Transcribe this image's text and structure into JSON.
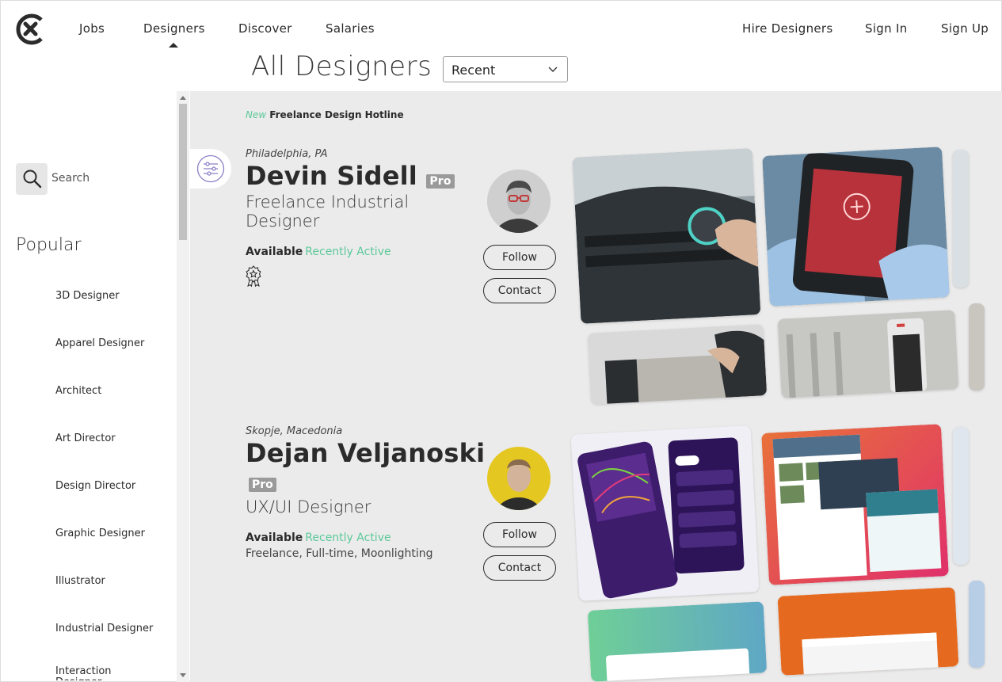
{
  "nav": {
    "logo_icon": "close-x-logo",
    "links": [
      "Jobs",
      "Designers",
      "Discover",
      "Salaries"
    ],
    "right_links": [
      "Hire Designers",
      "Sign In",
      "Sign Up"
    ],
    "active": "Designers"
  },
  "page": {
    "title": "All Designers",
    "sort": {
      "selected": "Recent"
    }
  },
  "sidebar": {
    "search_label": "Search",
    "popular_heading": "Popular",
    "items": [
      "3D Designer",
      "Apparel Designer",
      "Architect",
      "Art Director",
      "Design Director",
      "Graphic Designer",
      "Illustrator",
      "Industrial Designer",
      "Interaction Designer"
    ]
  },
  "main": {
    "hotline": {
      "new": "New",
      "text": "Freelance Design Hotline"
    },
    "designers": [
      {
        "location": "Philadelphia, PA",
        "name": "Devin Sidell",
        "pro": "Pro",
        "role": "Freelance Industrial Designer",
        "available": "Available",
        "status": "Recently Active",
        "follow": "Follow",
        "contact": "Contact"
      },
      {
        "location": "Skopje, Macedonia",
        "name": "Dejan Veljanoski",
        "pro": "Pro",
        "role": "UX/UI Designer",
        "available": "Available",
        "status": "Recently Active",
        "work_types": "Freelance, Full-time, Moonlighting",
        "follow": "Follow",
        "contact": "Contact"
      }
    ]
  },
  "colors": {
    "accent_green": "#5cc99a",
    "pro_badge": "#9a9a9a",
    "main_bg": "#ebebeb"
  }
}
